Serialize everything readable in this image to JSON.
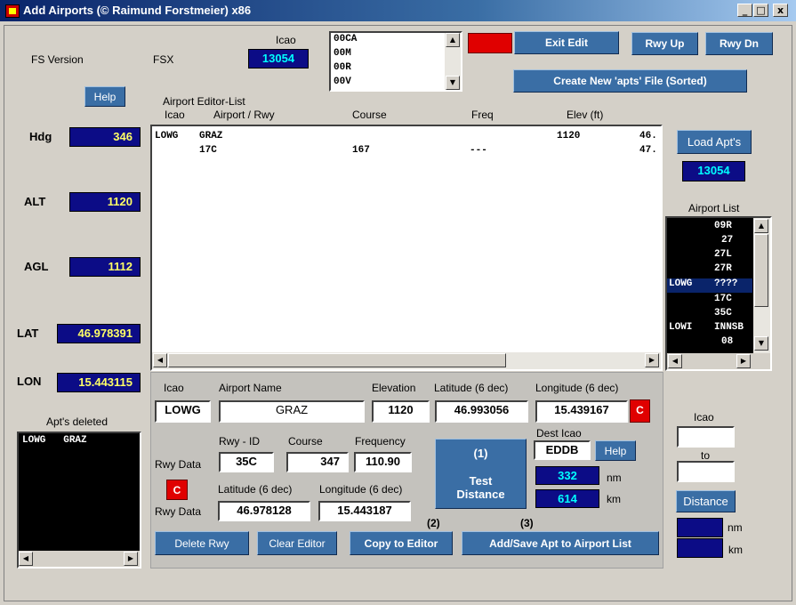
{
  "window": {
    "title": "Add Airports (© Raimund Forstmeier)  x86",
    "min": "_",
    "max": "□",
    "close": "x"
  },
  "top": {
    "fs_version_label": "FS Version",
    "fs_version_value": "FSX",
    "icao_label": "Icao",
    "icao_count": "13054",
    "icao_list": [
      "00CA",
      "00M",
      "00R",
      "00V"
    ],
    "exit_edit": "Exit Edit",
    "rwy_up": "Rwy Up",
    "rwy_dn": "Rwy Dn",
    "create_apts": "Create New 'apts' File (Sorted)"
  },
  "left": {
    "help": "Help",
    "hdg_label": "Hdg",
    "hdg_value": "346",
    "alt_label": "ALT",
    "alt_value": "1120",
    "agl_label": "AGL",
    "agl_value": "1112",
    "lat_label": "LAT",
    "lat_value": "46.978391",
    "lon_label": "LON",
    "lon_value": "15.443115",
    "deleted_label": "Apt's deleted",
    "deleted_rows": [
      {
        "icao": "LOWG",
        "name": "GRAZ"
      }
    ]
  },
  "editor": {
    "title": "Airport Editor-List",
    "columns": [
      "Icao",
      "Airport / Rwy",
      "Course",
      "Freq",
      "Elev (ft)"
    ],
    "rows": [
      {
        "icao": "LOWG",
        "name": "GRAZ",
        "course": "",
        "freq": "",
        "elev": "1120",
        "extra": "46."
      },
      {
        "icao": "",
        "name": "17C",
        "course": "167",
        "freq": "---",
        "elev": "",
        "extra": "47."
      }
    ]
  },
  "right": {
    "load_apts": "Load Apt's",
    "count": "13054",
    "airport_list_label": "Airport List",
    "airport_list": [
      {
        "icao": "",
        "rwy": "09R"
      },
      {
        "icao": "",
        "rwy": "27"
      },
      {
        "icao": "",
        "rwy": "27L"
      },
      {
        "icao": "",
        "rwy": "27R"
      },
      {
        "icao": "LOWG",
        "rwy": "????"
      },
      {
        "icao": "",
        "rwy": "17C"
      },
      {
        "icao": "",
        "rwy": "35C"
      },
      {
        "icao": "LOWI",
        "rwy": "INNSB"
      },
      {
        "icao": "",
        "rwy": "08"
      }
    ],
    "icao_label": "Icao",
    "to_label": "to",
    "distance_btn": "Distance",
    "nm_label": "nm",
    "km_label": "km"
  },
  "form": {
    "icao_label": "Icao",
    "icao_value": "LOWG",
    "name_label": "Airport Name",
    "name_value": "GRAZ",
    "elev_label": "Elevation",
    "elev_value": "1120",
    "lat_label": "Latitude (6 dec)",
    "lat_value": "46.993056",
    "lon_label": "Longitude (6 dec)",
    "lon_value": "15.439167",
    "c_btn": "C",
    "rwy_id_label": "Rwy - ID",
    "rwy_id_value": "35C",
    "course_label": "Course",
    "course_value": "347",
    "freq_label": "Frequency",
    "freq_value": "110.90",
    "rwy_data_label": "Rwy Data",
    "rwy_data_label2": "Rwy Data",
    "rwy_lat_label": "Latitude (6 dec)",
    "rwy_lat_value": "46.978128",
    "rwy_lon_label": "Longitude (6 dec)",
    "rwy_lon_value": "15.443187",
    "test_step": "(1)",
    "test_label": "Test Distance",
    "dest_icao_label": "Dest Icao",
    "dest_icao_value": "EDDB",
    "help": "Help",
    "dist_nm": "332",
    "nm_label": "nm",
    "dist_km": "614",
    "km_label": "km",
    "delete_rwy": "Delete Rwy",
    "clear_editor": "Clear Editor",
    "step2": "(2)",
    "copy_editor": "Copy to Editor",
    "step3": "(3)",
    "add_save": "Add/Save Apt to Airport List"
  },
  "colors": {
    "title_gradient_start": "#0a246a",
    "button": "#3a6ea5",
    "readout": "#0c0c86",
    "red": "#e00000"
  }
}
